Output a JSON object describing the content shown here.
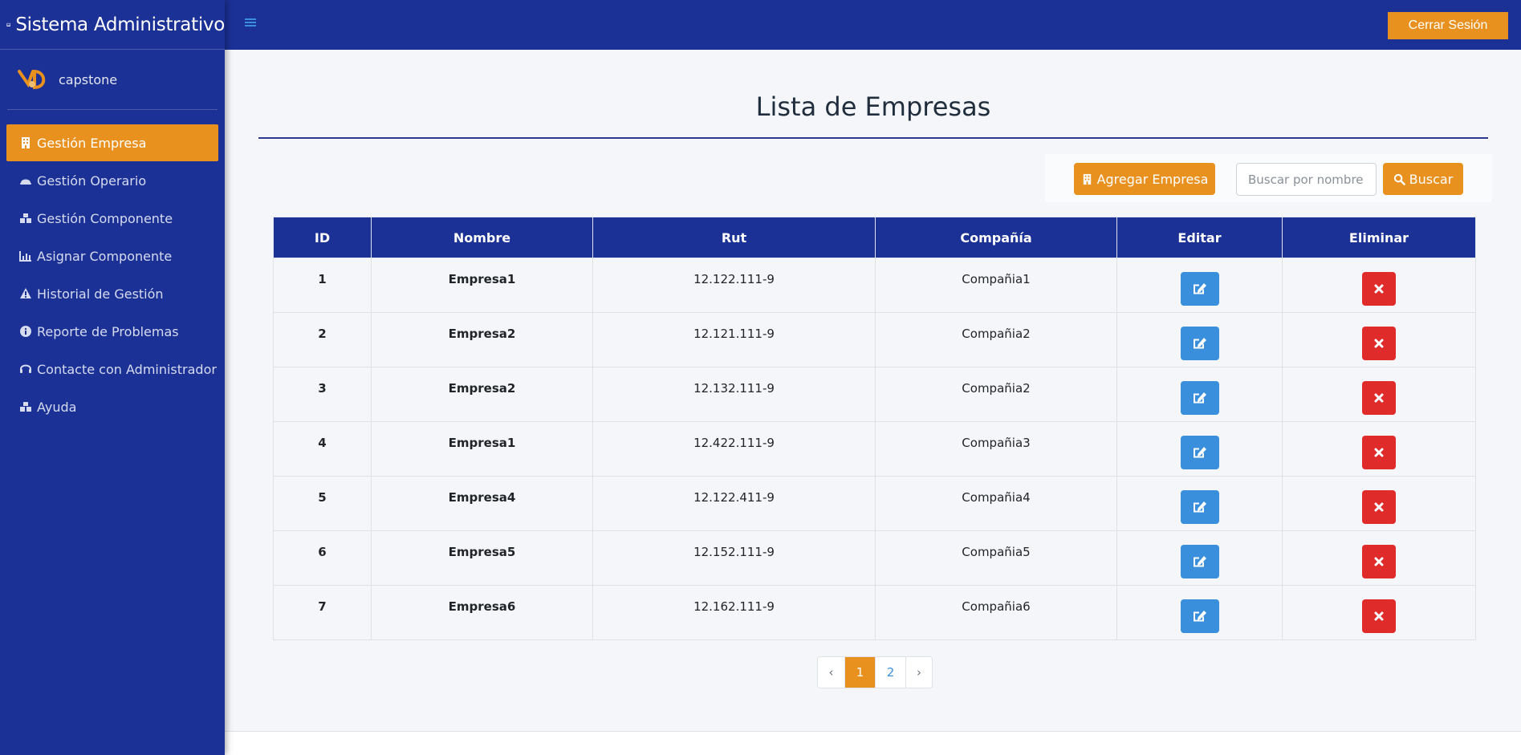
{
  "app": {
    "title": "Sistema Administrativo"
  },
  "user": {
    "name": "capstone"
  },
  "sidebar": {
    "items": [
      {
        "label": "Gestión Empresa",
        "icon": "building-icon",
        "active": true
      },
      {
        "label": "Gestión Operario",
        "icon": "hard-hat-icon",
        "active": false
      },
      {
        "label": "Gestión Componente",
        "icon": "boxes-icon",
        "active": false
      },
      {
        "label": "Asignar Componente",
        "icon": "chart-icon",
        "active": false
      },
      {
        "label": "Historial de Gestión",
        "icon": "warning-icon",
        "active": false
      },
      {
        "label": "Reporte de Problemas",
        "icon": "info-icon",
        "active": false
      },
      {
        "label": "Contacte con Administrador",
        "icon": "headset-icon",
        "active": false
      },
      {
        "label": "Ayuda",
        "icon": "boxes-icon",
        "active": false
      }
    ]
  },
  "header": {
    "logout_label": "Cerrar Sesión"
  },
  "main": {
    "title": "Lista de Empresas",
    "add_label": "Agregar Empresa",
    "search_placeholder": "Buscar por nombre",
    "search_label": "Buscar"
  },
  "table": {
    "headers": [
      "ID",
      "Nombre",
      "Rut",
      "Compañía",
      "Editar",
      "Eliminar"
    ],
    "rows": [
      {
        "id": "1",
        "nombre": "Empresa1",
        "rut": "12.122.111-9",
        "compania": "Compañia1"
      },
      {
        "id": "2",
        "nombre": "Empresa2",
        "rut": "12.121.111-9",
        "compania": "Compañia2"
      },
      {
        "id": "3",
        "nombre": "Empresa2",
        "rut": "12.132.111-9",
        "compania": "Compañia2"
      },
      {
        "id": "4",
        "nombre": "Empresa1",
        "rut": "12.422.111-9",
        "compania": "Compañia3"
      },
      {
        "id": "5",
        "nombre": "Empresa4",
        "rut": "12.122.411-9",
        "compania": "Compañia4"
      },
      {
        "id": "6",
        "nombre": "Empresa5",
        "rut": "12.152.111-9",
        "compania": "Compañia5"
      },
      {
        "id": "7",
        "nombre": "Empresa6",
        "rut": "12.162.111-9",
        "compania": "Compañia6"
      }
    ]
  },
  "pagination": {
    "prev": "‹",
    "pages": [
      "1",
      "2"
    ],
    "current": "1",
    "next": "›"
  },
  "colors": {
    "primary": "#1b3195",
    "accent": "#e8911f",
    "edit": "#3a8fdc",
    "delete": "#e02b2b"
  }
}
